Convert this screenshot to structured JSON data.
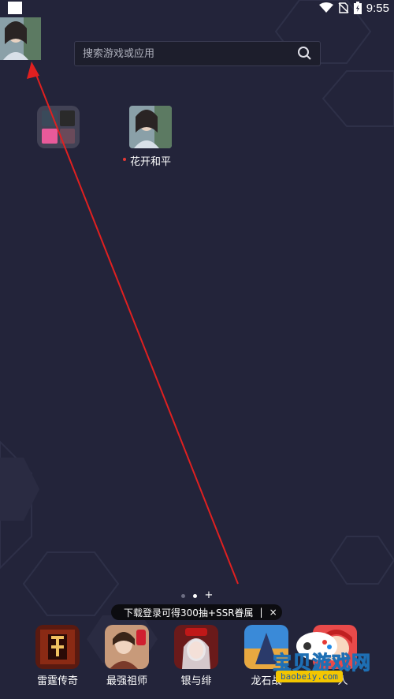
{
  "status_bar": {
    "time": "9:55"
  },
  "search": {
    "placeholder": "搜索游戏或应用"
  },
  "desktop": {
    "app": {
      "label": "花开和平"
    }
  },
  "banner": {
    "text": "下载登录可得300抽+SSR眷属",
    "separator": "|",
    "close": "×"
  },
  "pager": {
    "plus": "+"
  },
  "dock": [
    {
      "label": "雷霆传奇",
      "icon": "leiting-chuanqi-icon"
    },
    {
      "label": "最强祖师",
      "icon": "zuiqiang-zushi-icon"
    },
    {
      "label": "银与绯",
      "icon": "yin-yu-fei-icon"
    },
    {
      "label": "龙石战",
      "icon": "longshi-zhan-icon"
    },
    {
      "label": "人",
      "icon": "game-app-icon"
    }
  ],
  "watermark": {
    "text": "宝贝游戏网",
    "url": "baobeiy.com"
  },
  "colors": {
    "background": "#23243a",
    "arrow": "#e02020",
    "watermark_blue": "#3aa8f0",
    "watermark_yellow": "#f3c600"
  }
}
